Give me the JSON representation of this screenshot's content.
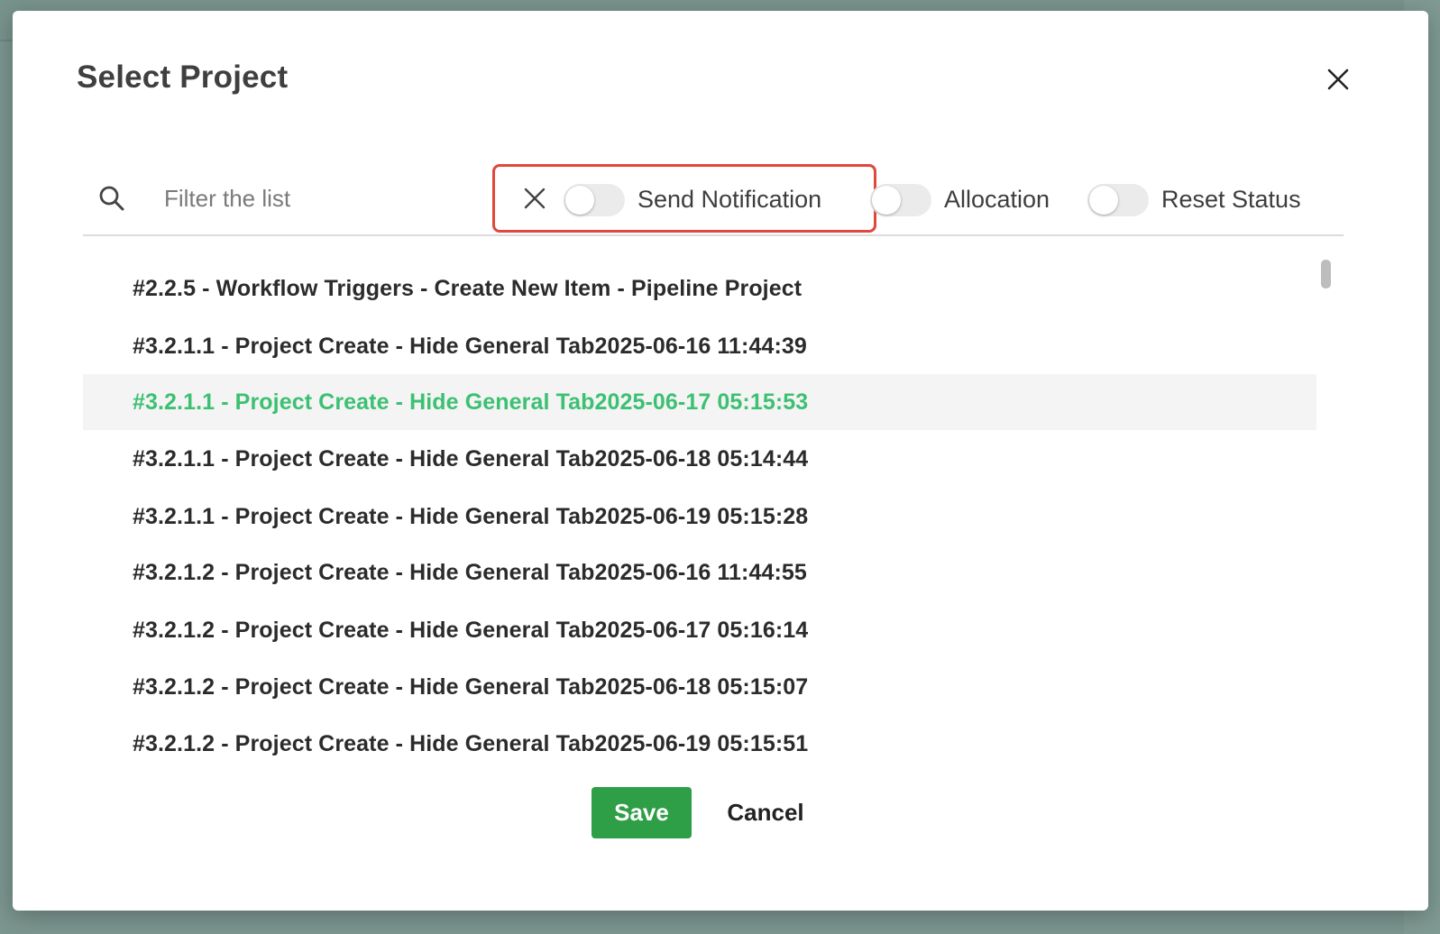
{
  "modal": {
    "title": "Select Project"
  },
  "toolbar": {
    "search_icon": "search-icon",
    "filter_placeholder": "Filter the list",
    "clear_icon": "close-icon",
    "toggles": [
      {
        "label": "Send Notification",
        "on": false
      },
      {
        "label": "Allocation",
        "on": false
      },
      {
        "label": "Reset Status",
        "on": false
      }
    ]
  },
  "colors": {
    "accent_green": "#3cc072",
    "save_button": "#2e9e47",
    "highlight_border": "#e0483e"
  },
  "projects": [
    {
      "label": "#2.2.5 - Workflow Triggers - Create New Item - Pipeline Project",
      "selected": false
    },
    {
      "label": "#3.2.1.1 - Project Create - Hide General Tab2025-06-16 11:44:39",
      "selected": false
    },
    {
      "label": "#3.2.1.1 - Project Create - Hide General Tab2025-06-17 05:15:53",
      "selected": true
    },
    {
      "label": "#3.2.1.1 - Project Create - Hide General Tab2025-06-18 05:14:44",
      "selected": false
    },
    {
      "label": "#3.2.1.1 - Project Create - Hide General Tab2025-06-19 05:15:28",
      "selected": false
    },
    {
      "label": "#3.2.1.2 - Project Create - Hide General Tab2025-06-16 11:44:55",
      "selected": false
    },
    {
      "label": "#3.2.1.2 - Project Create - Hide General Tab2025-06-17 05:16:14",
      "selected": false
    },
    {
      "label": "#3.2.1.2 - Project Create - Hide General Tab2025-06-18 05:15:07",
      "selected": false
    },
    {
      "label": "#3.2.1.2 - Project Create - Hide General Tab2025-06-19 05:15:51",
      "selected": false
    }
  ],
  "footer": {
    "save_label": "Save",
    "cancel_label": "Cancel"
  }
}
